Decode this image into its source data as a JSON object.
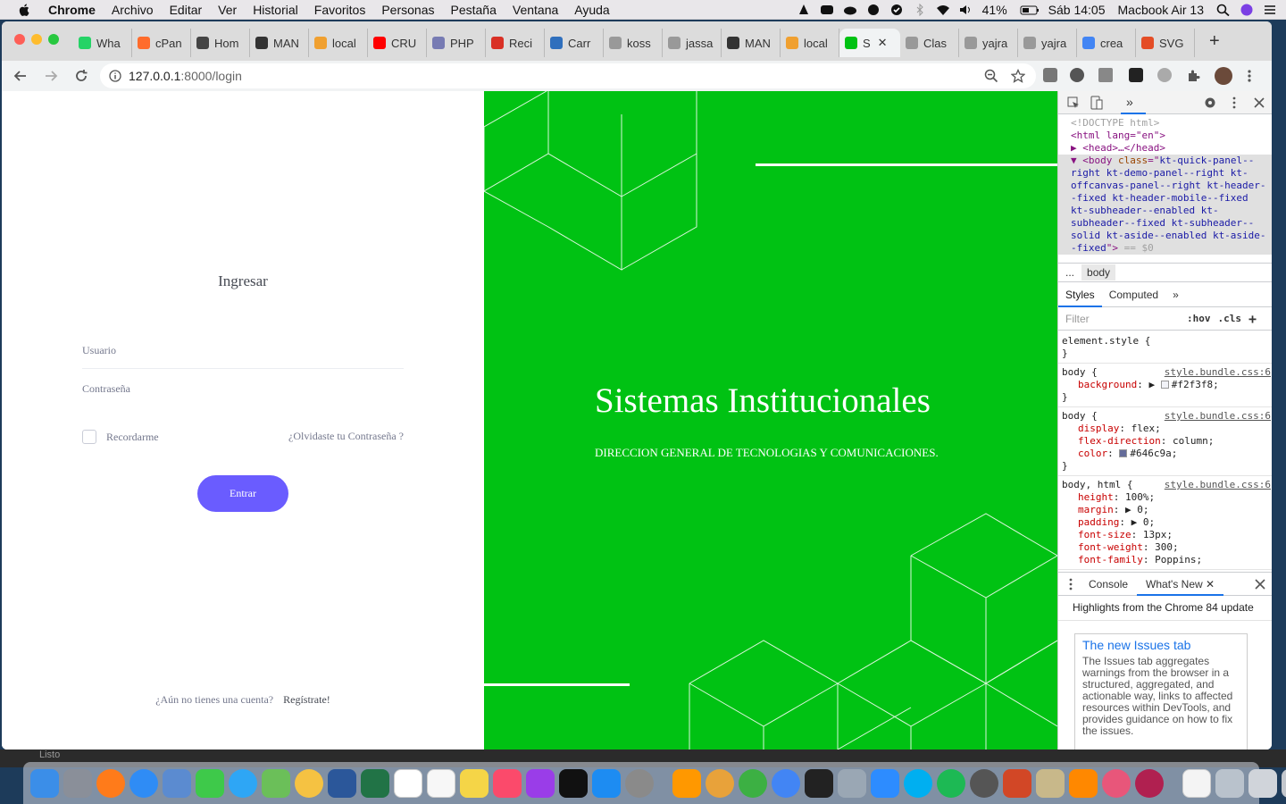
{
  "menubar": {
    "app_name": "Chrome",
    "items": [
      "Archivo",
      "Editar",
      "Ver",
      "Historial",
      "Favoritos",
      "Personas",
      "Pestaña",
      "Ventana",
      "Ayuda"
    ],
    "battery": "41%",
    "clock": "Sáb 14:05",
    "device": "Macbook Air 13"
  },
  "browser": {
    "tabs": [
      {
        "label": "Wha",
        "color": "#25d366"
      },
      {
        "label": "cPan",
        "color": "#ff6c2c"
      },
      {
        "label": "Hom",
        "color": "#444444"
      },
      {
        "label": "MAN",
        "color": "#333333"
      },
      {
        "label": "local",
        "color": "#f0a030"
      },
      {
        "label": "CRU",
        "color": "#ff0000"
      },
      {
        "label": "PHP",
        "color": "#777bb3"
      },
      {
        "label": "Reci",
        "color": "#d93025"
      },
      {
        "label": "Carr",
        "color": "#2f6fbd"
      },
      {
        "label": "koss",
        "color": "#999999"
      },
      {
        "label": "jassa",
        "color": "#999999"
      },
      {
        "label": "MAN",
        "color": "#333333"
      },
      {
        "label": "local",
        "color": "#f0a030"
      },
      {
        "label": "S",
        "color": "#00c213",
        "active": true
      },
      {
        "label": "Clas",
        "color": "#999999"
      },
      {
        "label": "yajra",
        "color": "#999999"
      },
      {
        "label": "yajra",
        "color": "#999999"
      },
      {
        "label": "crea",
        "color": "#4285f4"
      },
      {
        "label": "SVG",
        "color": "#e44d26"
      }
    ],
    "new_tab": "+",
    "url_host": "127.0.0.1",
    "url_path": ":8000/login"
  },
  "login": {
    "title": "Ingresar",
    "username_placeholder": "Usuario",
    "password_placeholder": "Contraseña",
    "remember_label": "Recordarme",
    "forgot_link": "¿Olvidaste tu Contraseña ?",
    "submit_label": "Entrar",
    "signup_prompt": "¿Aún no tienes una cuenta?",
    "signup_link": "Regístrate!"
  },
  "hero": {
    "background": "#00c213",
    "title": "Sistemas Institucionales",
    "subtitle": "DIRECCION GENERAL DE TECNOLOGIAS Y COMUNICACIONES."
  },
  "devtools": {
    "doctype": "<!DOCTYPE html>",
    "html_open": "<html lang=\"en\">",
    "head": "<head>…</head>",
    "body_class": "kt-quick-panel--right kt-demo-panel--right kt-offcanvas-panel--right kt-header--fixed kt-header-mobile--fixed kt-subheader--enabled kt-subheader--fixed kt-subheader--solid kt-aside--enabled kt-aside--fixed",
    "selected_marker": "== $0",
    "breadcrumb": "body",
    "tabs": {
      "styles": "Styles",
      "computed": "Computed"
    },
    "filter_placeholder": "Filter",
    "hov": ":hov",
    "cls": ".cls",
    "element_style": "element.style {",
    "source": "style.bundle.css:6",
    "rule1": {
      "selector": "body {",
      "prop": "background",
      "value": "#f2f3f8;"
    },
    "rule2": {
      "selector": "body {",
      "props": [
        [
          "display",
          "flex;"
        ],
        [
          "flex-direction",
          "column;"
        ],
        [
          "color",
          "#646c9a;"
        ]
      ]
    },
    "rule3": {
      "selector": "body, html {",
      "props": [
        [
          "height",
          "100%;"
        ],
        [
          "margin",
          "0;"
        ],
        [
          "padding",
          "0;"
        ],
        [
          "font-size",
          "13px;"
        ],
        [
          "font-weight",
          "300;"
        ],
        [
          "font-family",
          "Poppins;"
        ]
      ]
    },
    "drawer": {
      "console": "Console",
      "whatsnew": "What's New",
      "highlights": "Highlights from the Chrome 84 update",
      "card_title": "The new Issues tab",
      "card_text": "The Issues tab aggregates warnings from the browser in a structured, aggregated, and actionable way, links to affected resources within DevTools, and provides guidance on how to fix the issues."
    }
  },
  "terminal": {
    "status": "Listo"
  }
}
